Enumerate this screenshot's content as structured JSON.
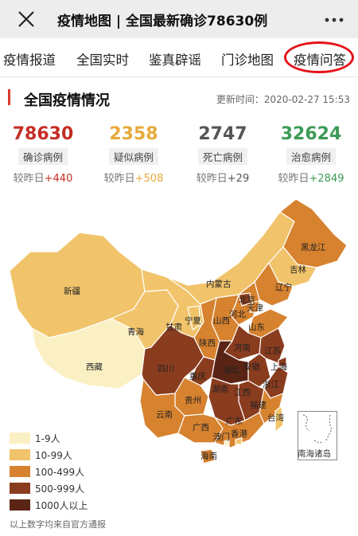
{
  "header": {
    "title": "疫情地图 | 全国最新确诊78630例"
  },
  "tabs": [
    "疫情报道",
    "全国实时",
    "鉴真辟谣",
    "门诊地图",
    "疫情问答"
  ],
  "section": {
    "title": "全国疫情情况",
    "updated": "更新时间：2020-02-27 15:53"
  },
  "stats": [
    {
      "value": "78630",
      "label": "确诊病例",
      "delta_prefix": "较昨日",
      "delta": "+440",
      "color": "#c52d25"
    },
    {
      "value": "2358",
      "label": "疑似病例",
      "delta_prefix": "较昨日",
      "delta": "+508",
      "color": "#e8a93b"
    },
    {
      "value": "2747",
      "label": "死亡病例",
      "delta_prefix": "较昨日",
      "delta": "+29",
      "color": "#555555"
    },
    {
      "value": "32624",
      "label": "治愈病例",
      "delta_prefix": "较昨日",
      "delta": "+2849",
      "color": "#3d9a57"
    }
  ],
  "map": {
    "colors": {
      "l1": "#fbf0c3",
      "l2": "#f1c46b",
      "l3": "#d7822f",
      "l4": "#8a3c1e",
      "l5": "#5a2414",
      "border": "#ffffff"
    },
    "provinces": {
      "heilongjiang": "黑龙江",
      "jilin": "吉林",
      "liaoning": "辽宁",
      "neimenggu": "内蒙古",
      "beijing": "北京",
      "tianjin": "天津",
      "hebei": "河北",
      "shanxi": "山西",
      "shandong": "山东",
      "xinjiang": "新疆",
      "qinghai": "青海",
      "gansu": "甘肃",
      "ningxia": "宁夏",
      "shaanxi": "陕西",
      "henan": "河南",
      "jiangsu": "江苏",
      "shanghai": "上海",
      "anhui": "安徽",
      "hubei": "湖北",
      "xizang": "西藏",
      "sichuan": "四川",
      "chongqing": "重庆",
      "zhejiang": "浙江",
      "hunan": "湖南",
      "jiangxi": "江西",
      "guizhou": "贵州",
      "yunnan": "云南",
      "fujian": "福建",
      "taiwan": "台湾",
      "guangxi": "广西",
      "guangdong": "广东",
      "aomen": "澳门",
      "xianggang": "香港",
      "hainan": "海南"
    },
    "inset_label": "南海诸岛"
  },
  "legend": [
    {
      "label": "1-9人",
      "color": "#fbf0c3"
    },
    {
      "label": "10-99人",
      "color": "#f1c46b"
    },
    {
      "label": "100-499人",
      "color": "#d7822f"
    },
    {
      "label": "500-999人",
      "color": "#8a3c1e"
    },
    {
      "label": "1000人以上",
      "color": "#5a2414"
    }
  ],
  "footnote": "以上数字均来自官方通报"
}
